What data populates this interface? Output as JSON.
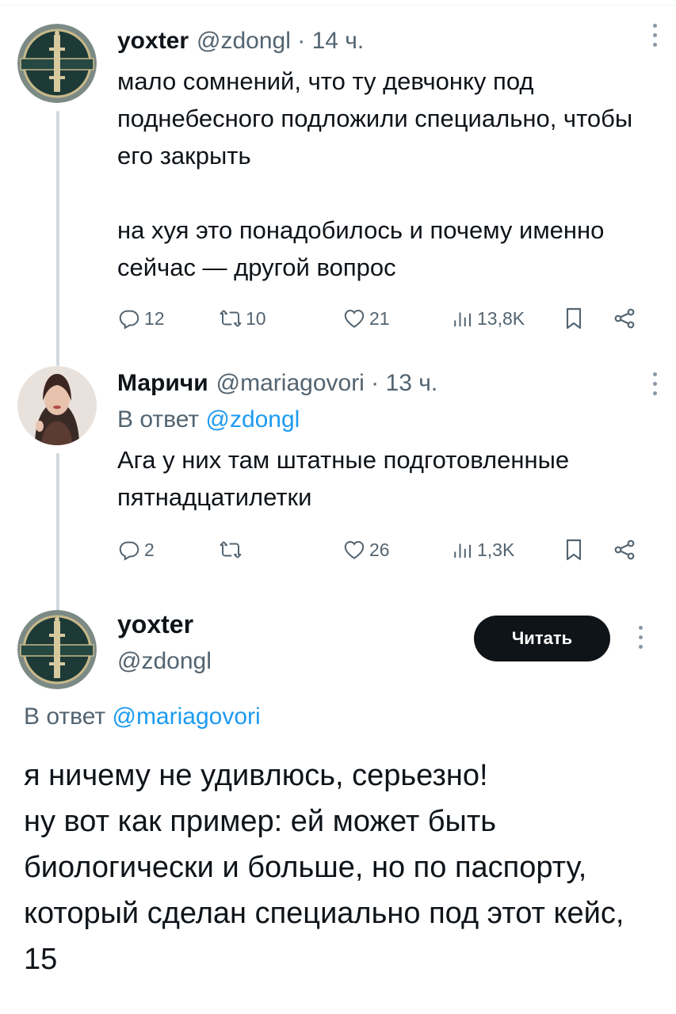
{
  "tweets": [
    {
      "name": "yoxter",
      "meta": "@zdongl · 14 ч.",
      "body": "мало сомнений, что ту девчонку под поднебесного подложили специально, чтобы его закрыть\n\nна хуя это понадобилось и почему именно сейчас — другой вопрос",
      "replies": "12",
      "retweets": "10",
      "likes": "21",
      "views": "13,8K"
    },
    {
      "name": "Маричи",
      "meta": "@mariagovori · 13 ч.",
      "reply_prefix": "В ответ ",
      "reply_mention": "@zdongl",
      "body": "Ага у них там штатные подготовленные пятнадцатилетки",
      "replies": "2",
      "retweets": "",
      "likes": "26",
      "views": "1,3K"
    }
  ],
  "main_tweet": {
    "name": "yoxter",
    "handle": "@zdongl",
    "follow_label": "Читать",
    "reply_prefix": "В ответ ",
    "reply_mention": "@mariagovori",
    "body": "я ничему не удивлюсь, серьезно!\nну вот как пример: ей может быть биологически и больше, но по паспорту, который сделан специально под этот кейс, 15"
  },
  "icons": {
    "reply": "reply-icon",
    "retweet": "retweet-icon",
    "like": "heart-icon",
    "views": "views-icon",
    "bookmark": "bookmark-icon",
    "share": "share-icon",
    "more": "more-icon"
  },
  "colors": {
    "text": "#0f1419",
    "secondary": "#536471",
    "link": "#1d9bf0",
    "button": "#0f1419"
  }
}
